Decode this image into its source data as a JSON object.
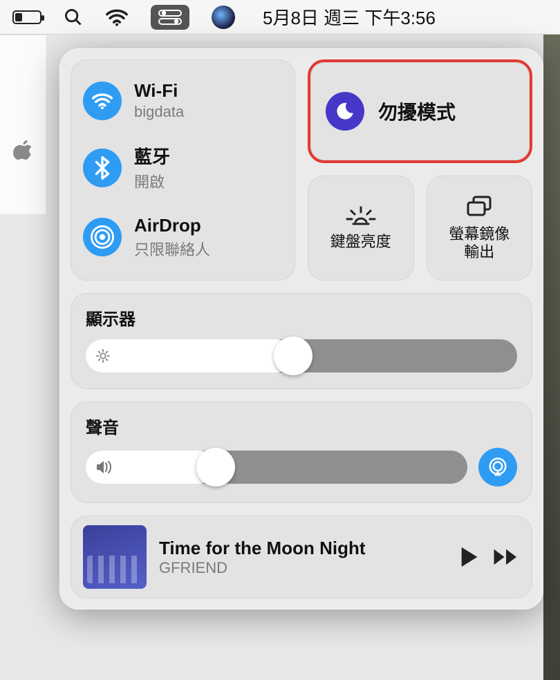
{
  "menubar": {
    "datetime": "5月8日 週三 下午3:56"
  },
  "connectivity": {
    "wifi": {
      "title": "Wi-Fi",
      "sub": "bigdata"
    },
    "bluetooth": {
      "title": "藍牙",
      "sub": "開啟"
    },
    "airdrop": {
      "title": "AirDrop",
      "sub": "只限聯絡人"
    }
  },
  "dnd": {
    "label": "勿擾模式"
  },
  "keyboard_brightness": {
    "label": "鍵盤亮度"
  },
  "screen_mirroring": {
    "label_line1": "螢幕鏡像",
    "label_line2": "輸出"
  },
  "display": {
    "title": "顯示器",
    "value_percent": 48
  },
  "sound": {
    "title": "聲音",
    "value_percent": 34
  },
  "music": {
    "title": "Time for the Moon Night",
    "artist": "GFRIEND"
  }
}
